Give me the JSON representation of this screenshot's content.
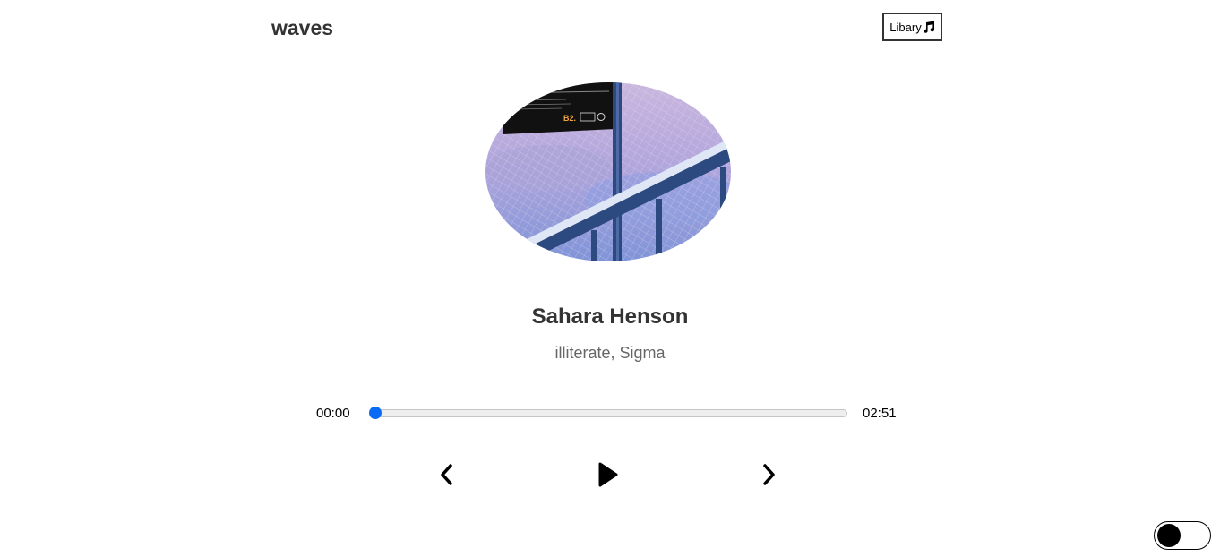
{
  "header": {
    "brand": "waves",
    "library_label": "Libary",
    "library_icon": "music-note-icon"
  },
  "song": {
    "title": "Sahara Henson",
    "artist": "illiterate, Sigma",
    "cover_badge": "B2."
  },
  "player": {
    "current_time": "00:00",
    "duration": "02:51",
    "progress": 0,
    "controls": {
      "prev_icon": "chevron-left-icon",
      "play_icon": "play-icon",
      "next_icon": "chevron-right-icon"
    }
  },
  "theme_toggle": {
    "state": "off"
  },
  "colors": {
    "accent": "#0a6cf5",
    "text": "#333333",
    "muted": "#666666"
  }
}
